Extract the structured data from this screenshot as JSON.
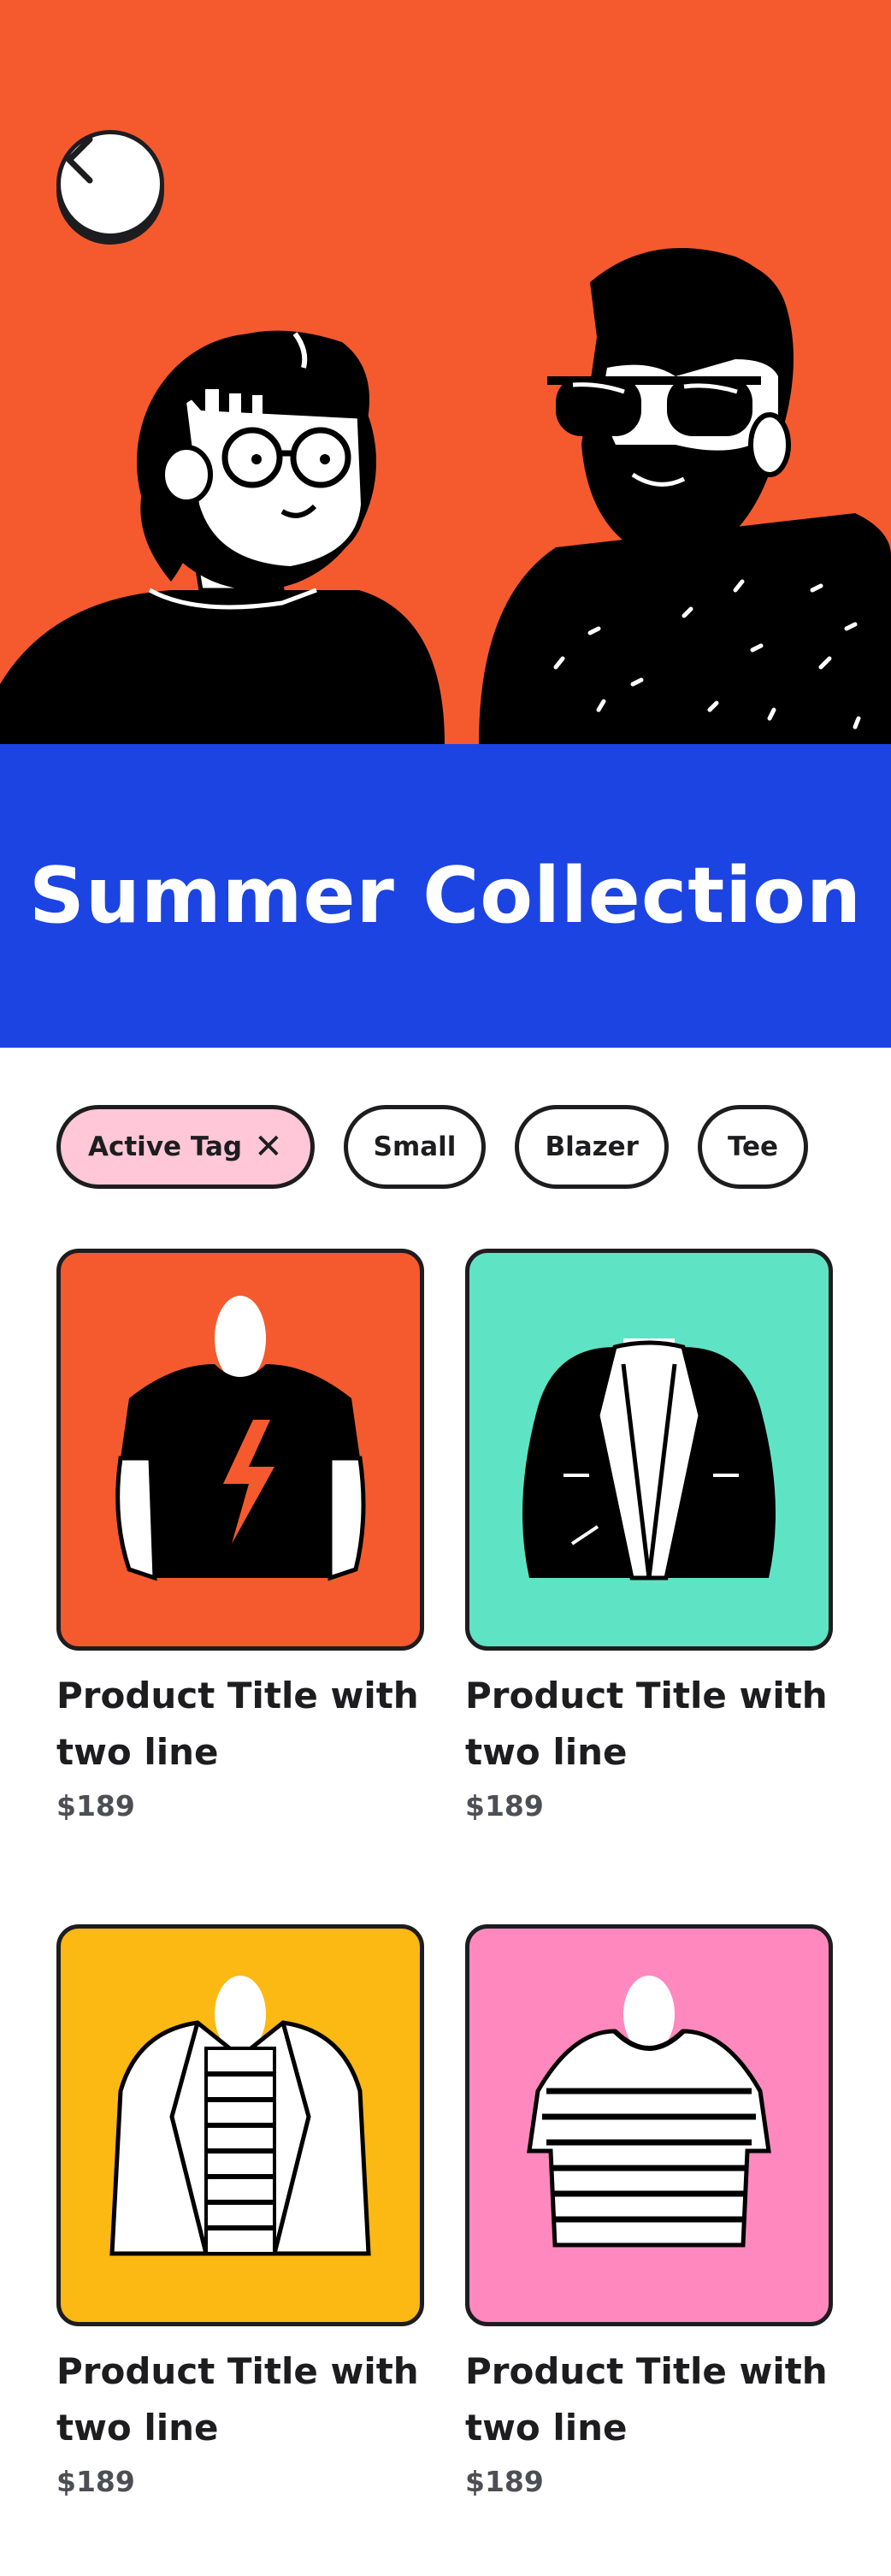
{
  "header": {
    "back_icon": "chevron-left-icon",
    "colors": {
      "hero": "#f55a2e",
      "banner": "#1c44e3"
    },
    "title": "Summer Collection"
  },
  "tags": [
    {
      "label": "Active Tag",
      "active": true,
      "icon": "close-icon"
    },
    {
      "label": "Small",
      "active": false
    },
    {
      "label": "Blazer",
      "active": false
    },
    {
      "label": "Tee",
      "active": false
    }
  ],
  "products": [
    {
      "title": "Product Title with two line",
      "price": "$189",
      "bg": "#f55a2e",
      "image": "black-tee-lightning"
    },
    {
      "title": "Product Title with two line",
      "price": "$189",
      "bg": "#5fe3c5",
      "image": "black-jacket"
    },
    {
      "title": "Product Title with two line",
      "price": "$189",
      "bg": "#fcb813",
      "image": "white-blazer-striped"
    },
    {
      "title": "Product Title with two line",
      "price": "$189",
      "bg": "#ff89bf",
      "image": "striped-tee"
    }
  ]
}
